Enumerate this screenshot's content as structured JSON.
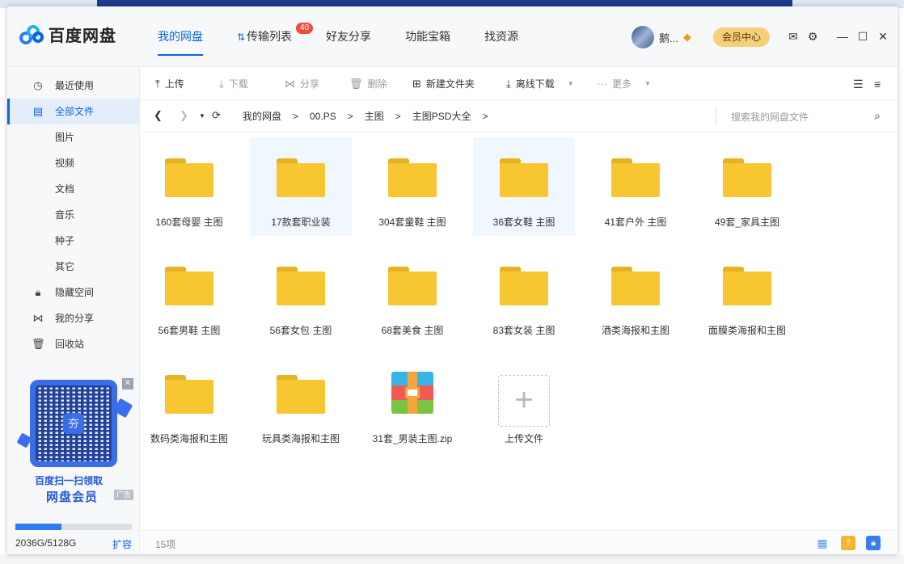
{
  "app": {
    "name": "百度网盘"
  },
  "nav": [
    {
      "label": "我的网盘",
      "active": true
    },
    {
      "label": "传输列表",
      "badge": "40"
    },
    {
      "label": "好友分享"
    },
    {
      "label": "功能宝箱"
    },
    {
      "label": "找资源"
    }
  ],
  "user": {
    "name": "鹅...",
    "member_button": "会员中心"
  },
  "sidebar": {
    "items": [
      {
        "label": "最近使用",
        "icon": "clock-icon"
      },
      {
        "label": "全部文件",
        "icon": "file-icon",
        "active": true
      },
      {
        "label": "图片"
      },
      {
        "label": "视频"
      },
      {
        "label": "文档"
      },
      {
        "label": "音乐"
      },
      {
        "label": "种子"
      },
      {
        "label": "其它"
      },
      {
        "label": "隐藏空间",
        "icon": "lock-icon"
      },
      {
        "label": "我的分享",
        "icon": "share-icon"
      },
      {
        "label": "回收站",
        "icon": "trash-icon"
      }
    ],
    "ad": {
      "line1": "百度扫一扫领取",
      "line2": "网盘会员",
      "tag": "广告"
    },
    "quota": {
      "text": "2036G/5128G",
      "used_fraction": 0.397,
      "expand": "扩容"
    }
  },
  "toolbar": {
    "upload": "上传",
    "download": "下载",
    "share": "分享",
    "delete": "删除",
    "new_folder": "新建文件夹",
    "offline_download": "离线下载",
    "more": "更多"
  },
  "path": {
    "crumbs": [
      "我的网盘",
      "00.PS",
      "主图",
      "主图PSD大全"
    ],
    "search_placeholder": "搜索我的网盘文件"
  },
  "files": [
    {
      "name": "160套母婴 主图",
      "type": "folder"
    },
    {
      "name": "17款套职业装",
      "type": "folder",
      "selected": true
    },
    {
      "name": "304套童鞋 主图",
      "type": "folder"
    },
    {
      "name": "36套女鞋 主图",
      "type": "folder",
      "selected": true
    },
    {
      "name": "41套户外 主图",
      "type": "folder"
    },
    {
      "name": "49套_家具主图",
      "type": "folder"
    },
    {
      "name": "56套男鞋 主图",
      "type": "folder"
    },
    {
      "name": "56套女包 主图",
      "type": "folder"
    },
    {
      "name": "68套美食 主图",
      "type": "folder"
    },
    {
      "name": "83套女装 主图",
      "type": "folder"
    },
    {
      "name": "酒类海报和主图",
      "type": "folder"
    },
    {
      "name": "面膜类海报和主图",
      "type": "folder"
    },
    {
      "name": "数码类海报和主图",
      "type": "folder"
    },
    {
      "name": "玩具类海报和主图",
      "type": "folder"
    },
    {
      "name": "31套_男装主图.zip",
      "type": "zip"
    },
    {
      "name": "上传文件",
      "type": "upload"
    }
  ],
  "status": {
    "count": "15项"
  },
  "colors": {
    "accent": "#0a63e8",
    "folder": "#f7c631",
    "member": "#f6cf7a"
  }
}
